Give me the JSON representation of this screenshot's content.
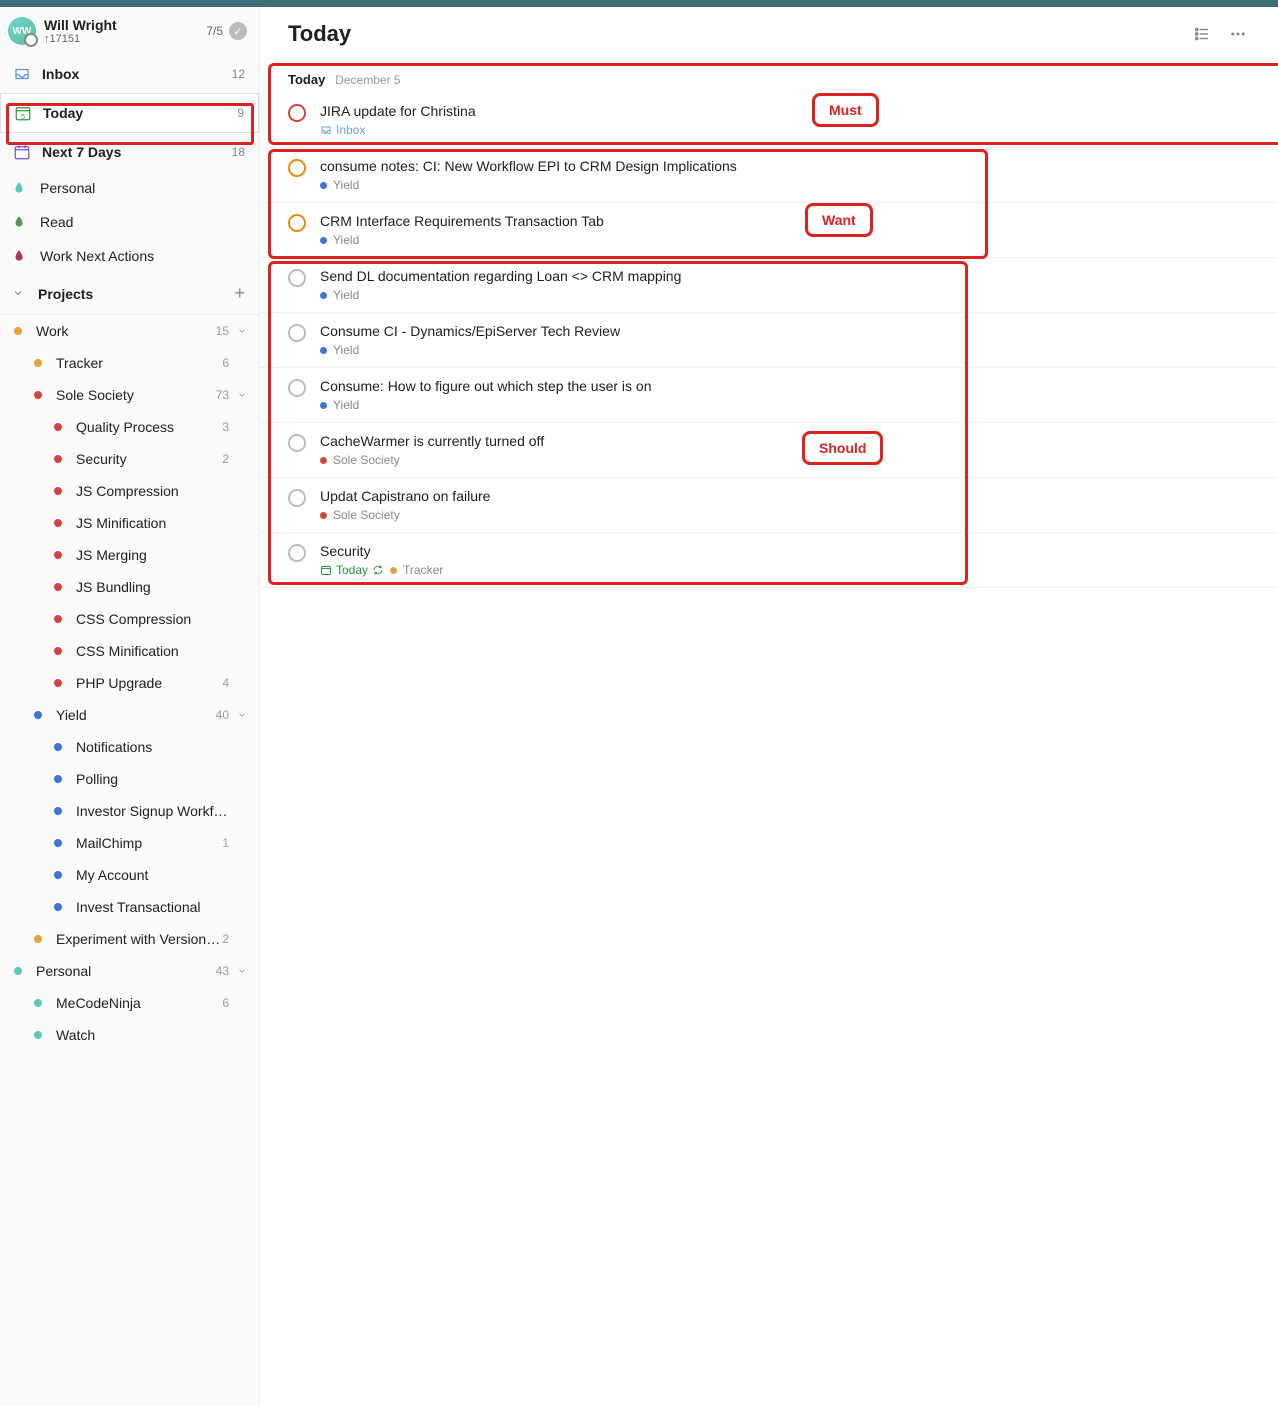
{
  "user": {
    "name": "Will Wright",
    "karma": "↑17151",
    "streak": "7/5",
    "initials": "WW"
  },
  "nav": {
    "inbox": {
      "label": "Inbox",
      "count": "12"
    },
    "today": {
      "label": "Today",
      "count": "9"
    },
    "next7": {
      "label": "Next 7 Days",
      "count": "18"
    }
  },
  "filters": [
    {
      "label": "Personal",
      "color": "#5ec6b8"
    },
    {
      "label": "Read",
      "color": "#4f9e4f"
    },
    {
      "label": "Work Next Actions",
      "color": "#b03060"
    }
  ],
  "projectsHeader": "Projects",
  "projects": [
    {
      "label": "Work",
      "count": "15",
      "indent": 1,
      "color": "#e6a23c",
      "expandable": true
    },
    {
      "label": "Tracker",
      "count": "6",
      "indent": 2,
      "color": "#e6a23c"
    },
    {
      "label": "Sole Society",
      "count": "73",
      "indent": 2,
      "color": "#d1453b",
      "expandable": true
    },
    {
      "label": "Quality Process",
      "count": "3",
      "indent": 3,
      "color": "#d1453b"
    },
    {
      "label": "Security",
      "count": "2",
      "indent": 3,
      "color": "#d1453b"
    },
    {
      "label": "JS Compression",
      "count": "",
      "indent": 3,
      "color": "#d1453b"
    },
    {
      "label": "JS Minification",
      "count": "",
      "indent": 3,
      "color": "#d1453b"
    },
    {
      "label": "JS Merging",
      "count": "",
      "indent": 3,
      "color": "#d1453b"
    },
    {
      "label": "JS Bundling",
      "count": "",
      "indent": 3,
      "color": "#d1453b"
    },
    {
      "label": "CSS Compression",
      "count": "",
      "indent": 3,
      "color": "#d1453b"
    },
    {
      "label": "CSS Minification",
      "count": "",
      "indent": 3,
      "color": "#d1453b"
    },
    {
      "label": "PHP Upgrade",
      "count": "4",
      "indent": 3,
      "color": "#d1453b"
    },
    {
      "label": "Yield",
      "count": "40",
      "indent": 2,
      "color": "#4073d6",
      "expandable": true
    },
    {
      "label": "Notifications",
      "count": "",
      "indent": 3,
      "color": "#4073d6"
    },
    {
      "label": "Polling",
      "count": "",
      "indent": 3,
      "color": "#4073d6"
    },
    {
      "label": "Investor Signup Workflow",
      "count": "",
      "indent": 3,
      "color": "#4073d6"
    },
    {
      "label": "MailChimp",
      "count": "1",
      "indent": 3,
      "color": "#4073d6"
    },
    {
      "label": "My Account",
      "count": "",
      "indent": 3,
      "color": "#4073d6"
    },
    {
      "label": "Invest Transactional",
      "count": "",
      "indent": 3,
      "color": "#4073d6"
    },
    {
      "label": "Experiment with Versioning a...",
      "count": "2",
      "indent": 2,
      "color": "#e6a23c"
    },
    {
      "label": "Personal",
      "count": "43",
      "indent": 1,
      "color": "#5ec6b8",
      "expandable": true
    },
    {
      "label": "MeCodeNinja",
      "count": "6",
      "indent": 2,
      "color": "#5ec6b8"
    },
    {
      "label": "Watch",
      "count": "",
      "indent": 2,
      "color": "#5ec6b8"
    }
  ],
  "main": {
    "title": "Today",
    "dateLabel": "Today",
    "dateSub": "December 5"
  },
  "tasks": [
    {
      "title": "JIRA update for Christina",
      "ring": "red",
      "metaType": "inbox",
      "metaLabel": "Inbox"
    },
    {
      "title": "consume notes: CI: New Workflow EPI to CRM Design Implications",
      "ring": "orange",
      "metaType": "dot",
      "metaColor": "#4073d6",
      "metaLabel": "Yield"
    },
    {
      "title": "CRM Interface Requirements Transaction Tab",
      "ring": "orange",
      "metaType": "dot",
      "metaColor": "#4073d6",
      "metaLabel": "Yield"
    },
    {
      "title": "Send DL documentation regarding Loan <> CRM mapping",
      "ring": "grey",
      "metaType": "dot",
      "metaColor": "#4073d6",
      "metaLabel": "Yield"
    },
    {
      "title": "Consume CI - Dynamics/EpiServer Tech Review",
      "ring": "grey",
      "metaType": "dot",
      "metaColor": "#4073d6",
      "metaLabel": "Yield"
    },
    {
      "title": "Consume: How to figure out which step the user is on",
      "ring": "grey",
      "metaType": "dot",
      "metaColor": "#4073d6",
      "metaLabel": "Yield"
    },
    {
      "title": "CacheWarmer is currently turned off",
      "ring": "grey",
      "metaType": "dot",
      "metaColor": "#d1453b",
      "metaLabel": "Sole Society"
    },
    {
      "title": "Updat Capistrano on failure",
      "ring": "grey",
      "metaType": "dot",
      "metaColor": "#d1453b",
      "metaLabel": "Sole Society"
    },
    {
      "title": "Security",
      "ring": "grey",
      "metaType": "today",
      "metaLabel": "Today",
      "extraColor": "#e6a23c",
      "extraLabel": "Tracker"
    }
  ],
  "annotations": {
    "must": "Must",
    "want": "Want",
    "should": "Should"
  }
}
